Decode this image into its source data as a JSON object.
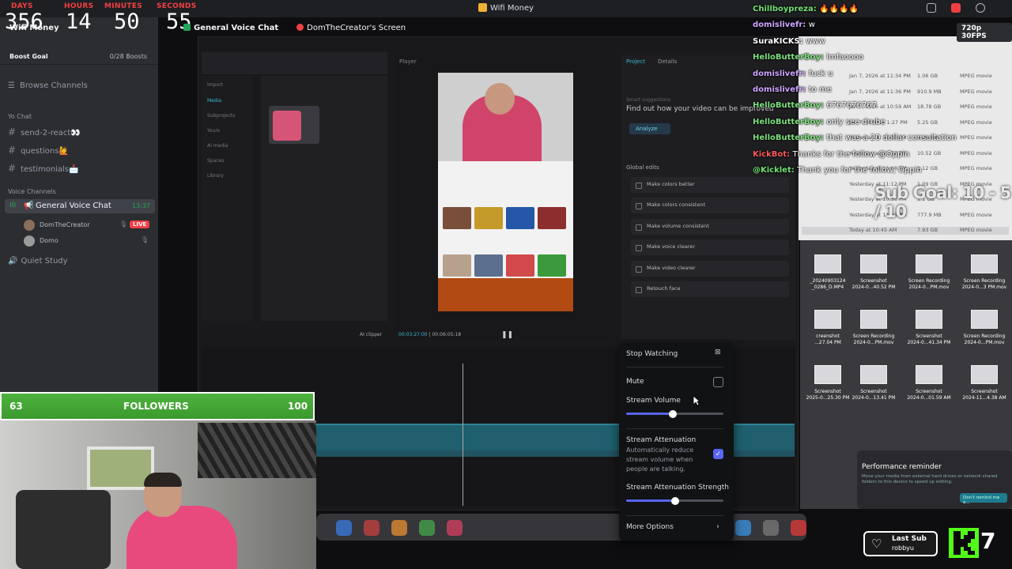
{
  "countdown": [
    {
      "label": "DAYS",
      "value": "356"
    },
    {
      "label": "HOURS",
      "value": "14"
    },
    {
      "label": "MINUTES",
      "value": "50"
    },
    {
      "label": "SECONDS",
      "value": "55"
    }
  ],
  "window_title": "Wifi Money",
  "sidebar": {
    "server_name": "Wifi Money",
    "boost_goal": "Boost Goal",
    "boost_count": "0/28 Boosts",
    "browse": "Browse Channels",
    "text_category": "Yo Chat",
    "text_channels": [
      "send-2-react👀",
      "questions🙋",
      "testimonials📩"
    ],
    "voice_category": "Voice Channels",
    "voice_channel": "General Voice Chat",
    "voice_time": "13:37",
    "voice_users": [
      {
        "name": "DomTheCreator",
        "live": "LIVE"
      },
      {
        "name": "Domo"
      }
    ],
    "quiet_channel": "Quiet Study"
  },
  "stream_header": {
    "channel": "General Voice Chat",
    "screen": "DomTheCreator's Screen",
    "quality": "720p 30FPS"
  },
  "capcut": {
    "menu": [
      "Import",
      "Media",
      "Subprojects",
      "Yours",
      "AI media",
      "Spaces",
      "Library"
    ],
    "player_label": "Player",
    "tabs": [
      "Project",
      "Details"
    ],
    "suggestions": "Smart suggestions",
    "find_text": "Find out how your video can be improved",
    "analyze": "Analyze",
    "global_edits": "Global edits",
    "edits": [
      "Make colors better",
      "Make colors consistent",
      "Make volume consistent",
      "Make voice clearer",
      "Make video clearer",
      "Retouch face"
    ],
    "time_current": "00:03:27:00",
    "time_total": "00:06:05:18",
    "ai_clipper": "AI clipper"
  },
  "finder_rows": [
    {
      "date": "Jan 7, 2026 at 11:34 PM",
      "size": "1.06 GB",
      "kind": "MPEG movie"
    },
    {
      "date": "Jan 7, 2026 at 11:36 PM",
      "size": "910.9 MB",
      "kind": "MPEG movie"
    },
    {
      "date": "Jan 7, 2026 at 10:59 AM",
      "size": "18.78 GB",
      "kind": "MPEG movie"
    },
    {
      "date": "Jan 7, 2026 at 1:27 PM",
      "size": "5.25 GB",
      "kind": "MPEG movie"
    },
    {
      "date": "Yesterday at 11:33 PM",
      "size": "8.96 GB",
      "kind": "MPEG movie"
    },
    {
      "date": "Yesterday at 11:24 PM",
      "size": "10.52 GB",
      "kind": "MPEG movie"
    },
    {
      "date": "Yesterday at 11:08 PM",
      "size": "1.12 GB",
      "kind": "MPEG movie"
    },
    {
      "date": "Yesterday at 11:12 PM",
      "size": "1.09 GB",
      "kind": "MPEG movie"
    },
    {
      "date": "Yesterday at 10:56 PM",
      "size": "1.1 GB",
      "kind": "MPEG movie"
    },
    {
      "date": "Yesterday at 11:03 PM",
      "size": "777.9 MB",
      "kind": "MPEG movie"
    },
    {
      "date": "Today at 10:45 AM",
      "size": "7.93 GB",
      "kind": "MPEG movie"
    }
  ],
  "desktop_icons": [
    {
      "label": "_20240903124\n_0286_D.MP4"
    },
    {
      "label": "Screenshot\n2024-0...40.52 PM"
    },
    {
      "label": "Screen Recording\n2024-0...PM.mov"
    },
    {
      "label": "Screen Recording\n2024-0...3 PM.mov"
    },
    {
      "label": "creenshot\n...27.04 PM"
    },
    {
      "label": "Screen Recording\n2024-0...PM.mov"
    },
    {
      "label": "Screenshot\n2024-0...41.34 PM"
    },
    {
      "label": "Screen Recording\n2024-0...PM.mov"
    },
    {
      "label": "Screenshot\n2025-0...25.30 PM"
    },
    {
      "label": "Screenshot\n2024-0...13.41 PM"
    },
    {
      "label": "Screenshot\n2024-0...01.59 AM"
    },
    {
      "label": "Screenshot\n2024-11...4.38 AM"
    }
  ],
  "perf": {
    "title": "Performance reminder",
    "body": "Move your media from external hard drives or network shared folders to this device to speed up editing.",
    "button": "Don't remind me a..."
  },
  "chat": [
    {
      "user": "Chillboypreza:",
      "msg": "🔥🔥🔥🔥",
      "color": "#6fe36f"
    },
    {
      "user": "domislivefr:",
      "msg": "w",
      "color": "#cfa3ff"
    },
    {
      "user": "SuraKICKS:",
      "msg": "www",
      "color": "#ffffff"
    },
    {
      "user": "HelloButterBoy:",
      "msg": "lmfaoooo",
      "color": "#7ee07e"
    },
    {
      "user": "domislivefr:",
      "msg": "fuck u",
      "color": "#cfa3ff"
    },
    {
      "user": "domislivefr:",
      "msg": "to me",
      "color": "#cfa3ff"
    },
    {
      "user": "HelloButterBoy:",
      "msg": "6767676767",
      "color": "#7ee07e"
    },
    {
      "user": "HelloButterBoy:",
      "msg": "only see drube",
      "color": "#7ee07e"
    },
    {
      "user": "HelloButterBoy:",
      "msg": "that was a 20 dollar consultation",
      "color": "#7ee07e"
    },
    {
      "user": "KickBot:",
      "msg": "Thanks for the follow @Oppin",
      "color": "#ff5a5a"
    },
    {
      "user": "@Kicklet:",
      "msg": "Thank you for the follow, Oppin",
      "color": "#6fe36f"
    }
  ],
  "sub_goal": "Sub Goal: 10 - 5 / 10",
  "voice_menu": {
    "stop_watching": "Stop Watching",
    "mute": "Mute",
    "stream_volume": "Stream Volume",
    "stream_volume_level": 0.48,
    "attenuation": "Stream Attenuation",
    "attenuation_desc": "Automatically reduce stream volume when people are talking.",
    "attenuation_enabled": true,
    "attenuation_strength": "Stream Attenuation Strength",
    "attenuation_strength_level": 0.5,
    "more_options": "More Options"
  },
  "followers": {
    "current": "63",
    "label": "FOLLOWERS",
    "goal": "100"
  },
  "last_sub": {
    "label": "Last Sub",
    "name": "robbyu"
  },
  "kick_count": "7"
}
